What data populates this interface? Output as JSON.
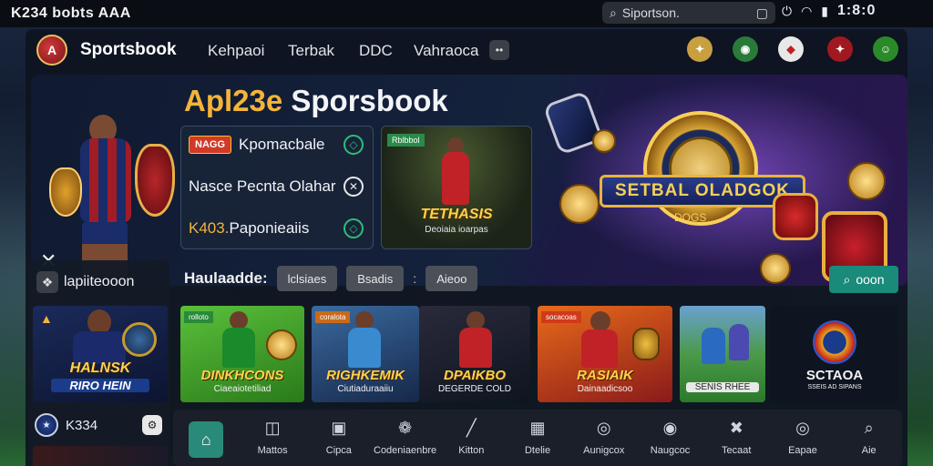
{
  "statusbar": {
    "title": "K234 bobts AAA",
    "search_text": "Siportson.",
    "time": "1:8:0"
  },
  "nav": {
    "brand": "Sportsbook",
    "brand_logo_text": "A",
    "links": [
      "Kehpaoi",
      "Terbak",
      "DDC",
      "Vahraoca"
    ],
    "more_label": "••"
  },
  "hero": {
    "title_a": "Apl23e",
    "title_b": "Sporsbook",
    "offers": [
      {
        "tag": "NAGG",
        "text": "Kpomacbale",
        "highlight": "",
        "icon": "◇"
      },
      {
        "tag": "",
        "text": "Nasce Pecnta Olahar",
        "highlight": "",
        "icon": "✕"
      },
      {
        "tag": "",
        "text": " Paponieaiis",
        "highlight": "K403.",
        "icon": "◇"
      }
    ],
    "feature": {
      "tag": "Rblbbol",
      "title": "TETHASIS",
      "subtitle": "Deoiaia ioarpas"
    },
    "promo": {
      "banner": "SETBAL OLADGOK",
      "sub": "DOGS"
    }
  },
  "side": {
    "title": "lapiiteooon",
    "banner_title": "HALNSK",
    "banner_sub": "RIRO HEIN",
    "footer_label": "K334"
  },
  "filter": {
    "label": "Haulaadde:",
    "chips": [
      "lclsiaes",
      "Bsadis"
    ],
    "separator": ":",
    "chip3": "Aieoo",
    "search_label": "ooon"
  },
  "tiles": [
    {
      "tag": "rolloto",
      "title": "DINKHCONS",
      "sub": "Ciaeaiotetiliad",
      "bg": "#3a9a2a"
    },
    {
      "tag": "coralota",
      "title": "RIGHKEMIK",
      "sub": "Ciutiaduraaiiu",
      "bg": "#2a4a7a"
    },
    {
      "tag": "",
      "title": "DPAIKBO",
      "sub": "DEGERDE COLD",
      "bg": "#1a2a3a"
    },
    {
      "tag": "socacoas",
      "title": "RASIAIK",
      "sub": "Dainaadicsoo",
      "bg": "#c04a1a"
    },
    {
      "tag": "",
      "title": "",
      "sub": "SENIS RHEE",
      "bg": "#3a8a3a"
    },
    {
      "tag": "",
      "title": "SCTAOA",
      "sub": "SSEIS AD SIPANS",
      "bg": "#0e1420"
    }
  ],
  "dock": [
    {
      "label": "",
      "icon": "⌂",
      "active": true
    },
    {
      "label": "Mattos",
      "icon": "◫",
      "active": false
    },
    {
      "label": "Cipca",
      "icon": "▣",
      "active": false
    },
    {
      "label": "Codeniaenbre",
      "icon": "❁",
      "active": false
    },
    {
      "label": "Kitton",
      "icon": "╱",
      "active": false
    },
    {
      "label": "Dtelie",
      "icon": "▦",
      "active": false
    },
    {
      "label": "Aunigcox",
      "icon": "◎",
      "active": false
    },
    {
      "label": "Naugcoc",
      "icon": "◉",
      "active": false
    },
    {
      "label": "Tecaat",
      "icon": "✖",
      "active": false
    },
    {
      "label": "Eapae",
      "icon": "◎",
      "active": false
    },
    {
      "label": "Aie",
      "icon": "⌕",
      "active": false
    }
  ],
  "colors": {
    "accent": "#1a8a7a",
    "gold": "#f4b43a",
    "promo_purple": "#7a3ad0"
  }
}
